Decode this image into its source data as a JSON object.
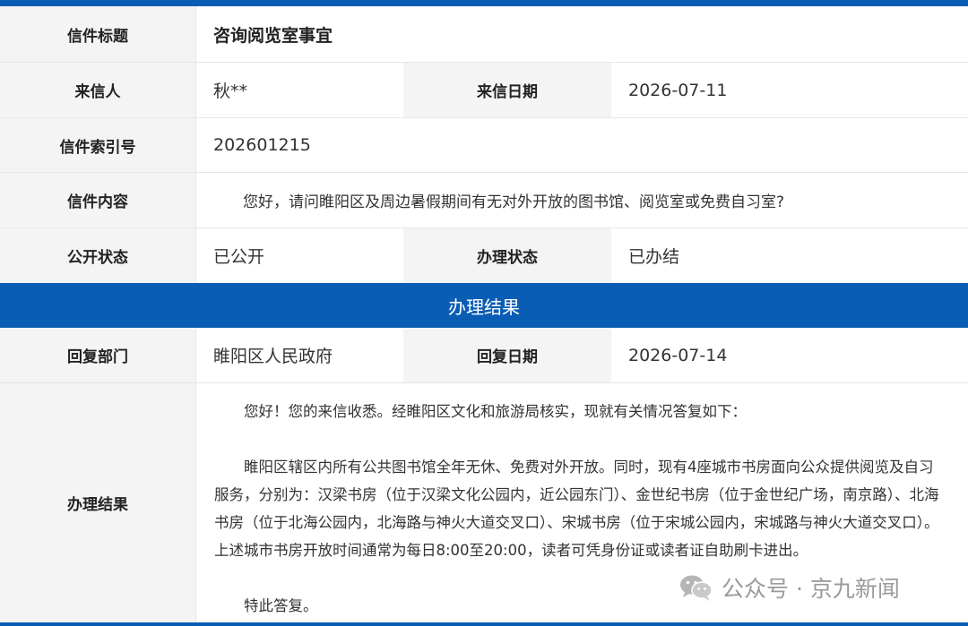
{
  "letter": {
    "title_label": "信件标题",
    "title_value": "咨询阅览室事宜",
    "sender_label": "来信人",
    "sender_value": "秋**",
    "date_label": "来信日期",
    "date_value": "2026-07-11",
    "index_label": "信件索引号",
    "index_value": "202601215",
    "content_label": "信件内容",
    "content_value": "您好，请问睢阳区及周边暑假期间有无对外开放的图书馆、阅览室或免费自习室?",
    "public_label": "公开状态",
    "public_value": "已公开",
    "handle_label": "办理状态",
    "handle_value": "已办结"
  },
  "result": {
    "section_title": "办理结果",
    "dept_label": "回复部门",
    "dept_value": "睢阳区人民政府",
    "reply_date_label": "回复日期",
    "reply_date_value": "2026-07-14",
    "result_label": "办理结果",
    "para1": "您好！您的来信收悉。经睢阳区文化和旅游局核实，现就有关情况答复如下：",
    "para2": "睢阳区辖区内所有公共图书馆全年无休、免费对外开放。同时，现有4座城市书房面向公众提供阅览及自习服务，分别为：汉梁书房（位于汉梁文化公园内，近公园东门）、金世纪书房（位于金世纪广场，南京路）、北海书房（位于北海公园内，北海路与神火大道交叉口）、宋城书房（位于宋城公园内，宋城路与神火大道交叉口）。上述城市书房开放时间通常为每日8:00至20:00，读者可凭身份证或读者证自助刷卡进出。",
    "para3": "特此答复。"
  },
  "watermark": {
    "text": "公众号 · 京九新闻",
    "icon": "wechat-icon"
  },
  "colors": {
    "accent": "#0a5db4",
    "label_bg": "#f4f4f4",
    "border": "#e6e6e6"
  }
}
